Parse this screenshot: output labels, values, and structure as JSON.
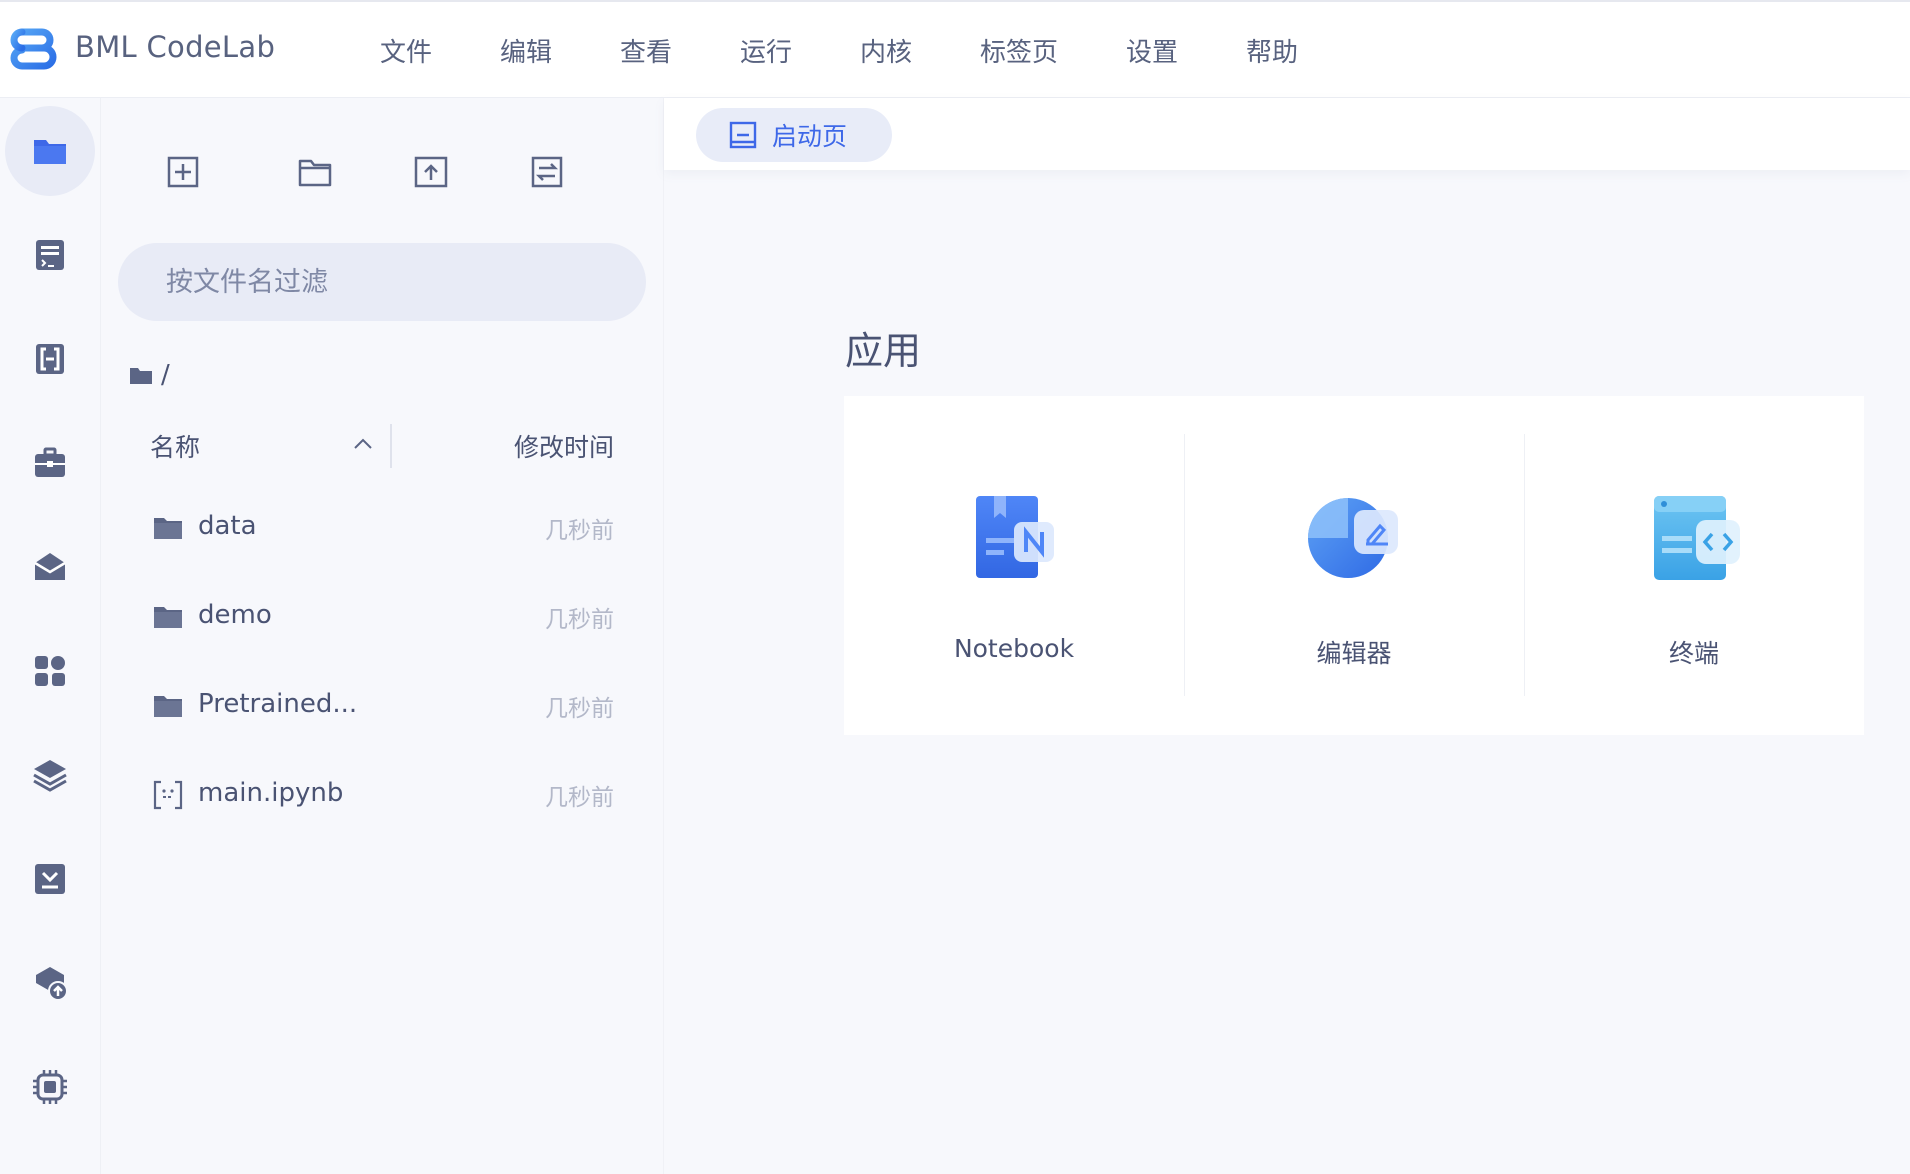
{
  "app": {
    "name": "BML CodeLab"
  },
  "menu": [
    "文件",
    "编辑",
    "查看",
    "运行",
    "内核",
    "标签页",
    "设置",
    "帮助"
  ],
  "activity_bar": [
    {
      "icon": "folder-icon",
      "active": true
    },
    {
      "icon": "code-file-icon",
      "active": false
    },
    {
      "icon": "bracket-icon",
      "active": false
    },
    {
      "icon": "toolbox-icon",
      "active": false
    },
    {
      "icon": "open-mail-icon",
      "active": false
    },
    {
      "icon": "apps-grid-icon",
      "active": false
    },
    {
      "icon": "layers-icon",
      "active": false
    },
    {
      "icon": "download-icon",
      "active": false
    },
    {
      "icon": "cloud-upload-icon",
      "active": false
    },
    {
      "icon": "chip-icon",
      "active": false
    }
  ],
  "file_toolbar": [
    "new-launcher-icon",
    "new-folder-icon",
    "upload-icon",
    "refresh-icon"
  ],
  "file_browser": {
    "filter_placeholder": "按文件名过滤",
    "path": "/",
    "columns": {
      "name": "名称",
      "modified": "修改时间"
    },
    "files": [
      {
        "name": "data",
        "type": "folder",
        "modified": "几秒前"
      },
      {
        "name": "demo",
        "type": "folder",
        "modified": "几秒前"
      },
      {
        "name": "Pretrained...",
        "type": "folder",
        "modified": "几秒前"
      },
      {
        "name": "main.ipynb",
        "type": "notebook",
        "modified": "几秒前"
      }
    ]
  },
  "tabs": [
    {
      "label": "启动页",
      "icon": "launcher-tab-icon"
    }
  ],
  "launcher": {
    "section_title": "应用",
    "apps": [
      {
        "label": "Notebook",
        "icon": "notebook-icon"
      },
      {
        "label": "编辑器",
        "icon": "editor-icon"
      },
      {
        "label": "终端",
        "icon": "terminal-icon"
      }
    ]
  },
  "colors": {
    "accent": "#3e68e8",
    "icon": "#5b6585",
    "text": "#4a5373",
    "muted": "#b3b8c9",
    "panel": "#f7f8fc",
    "pill": "#e8ebf6"
  }
}
